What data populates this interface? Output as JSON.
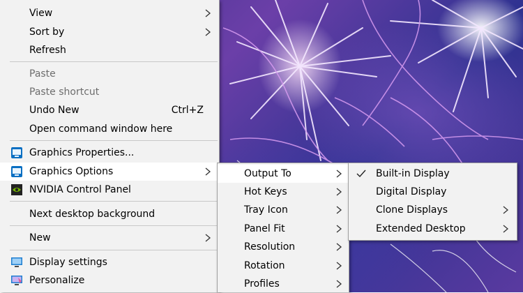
{
  "main_menu": {
    "view": "View",
    "sort_by": "Sort by",
    "refresh": "Refresh",
    "paste": "Paste",
    "paste_shortcut": "Paste shortcut",
    "undo_new": "Undo New",
    "undo_new_shortcut": "Ctrl+Z",
    "open_command_window": "Open command window here",
    "graphics_properties": "Graphics Properties...",
    "graphics_options": "Graphics Options",
    "nvidia_control_panel": "NVIDIA Control Panel",
    "next_desktop_background": "Next desktop background",
    "new": "New",
    "display_settings": "Display settings",
    "personalize": "Personalize"
  },
  "graphics_options_submenu": {
    "output_to": "Output To",
    "hot_keys": "Hot Keys",
    "tray_icon": "Tray Icon",
    "panel_fit": "Panel Fit",
    "resolution": "Resolution",
    "rotation": "Rotation",
    "profiles": "Profiles"
  },
  "output_to_submenu": {
    "built_in_display": "Built-in Display",
    "digital_display": "Digital Display",
    "clone_displays": "Clone Displays",
    "extended_desktop": "Extended Desktop",
    "checked_item": "Built-in Display"
  },
  "icons": {
    "intel_graphics": "intel-graphics-icon",
    "nvidia": "nvidia-icon",
    "display_settings": "display-settings-icon",
    "personalize": "personalize-icon"
  },
  "colors": {
    "menu_background": "#f2f2f2",
    "highlight": "#ffffff",
    "disabled_text": "#6d6d6d",
    "separator": "#c8c8c8"
  }
}
